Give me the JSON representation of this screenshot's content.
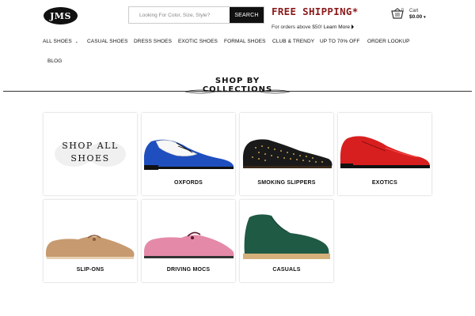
{
  "header": {
    "logo_text": "JMS",
    "search": {
      "placeholder": "Looking For Color, Size, Style?",
      "button_label": "SEARCH"
    },
    "promo": {
      "title": "FREE SHIPPING*",
      "subtitle": "For orders above $50!",
      "link": "Learn More"
    },
    "cart": {
      "label": "Cart",
      "count": "0",
      "total": "$0.00"
    }
  },
  "nav": {
    "items": [
      "ALL SHOES",
      "CASUAL SHOES",
      "DRESS SHOES",
      "EXOTIC SHOES",
      "FORMAL SHOES",
      "CLUB & TRENDY",
      "UP TO 70% OFF",
      "ORDER LOOKUP",
      "BLOG"
    ]
  },
  "section": {
    "title_line1": "SHOP BY",
    "title_line2": "COLLECTIONS"
  },
  "collections": [
    {
      "label": "SHOP ALL SHOES",
      "line1": "SHOP ALL",
      "line2": "SHOES"
    },
    {
      "label": "OXFORDS",
      "color": "#1f4fbf"
    },
    {
      "label": "SMOKING SLIPPERS",
      "color": "#1a1a1a"
    },
    {
      "label": "EXOTICS",
      "color": "#d81f1f"
    },
    {
      "label": "SLIP-ONS",
      "color": "#c79a70"
    },
    {
      "label": "DRIVING MOCS",
      "color": "#e48aa8"
    },
    {
      "label": "CASUALS",
      "color": "#1f5a45"
    }
  ],
  "colors": {
    "brand": "#111111",
    "promo": "#8b1a1a"
  }
}
